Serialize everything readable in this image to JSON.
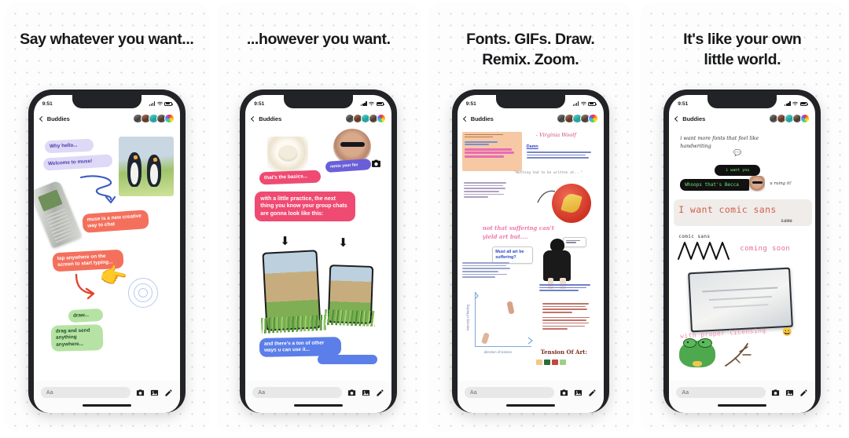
{
  "app": {
    "name": "muse",
    "status_time": "9:51",
    "nav_back_label": "Buddies",
    "input_placeholder": "Aa",
    "input_icons": [
      "camera-icon",
      "photo-icon",
      "pencil-icon"
    ],
    "status_icons": [
      "signal-icon",
      "wifi-icon",
      "battery-icon"
    ],
    "avatar_count": 5
  },
  "colors": {
    "page_bg": "#ffffff",
    "panel_bg": "#fdfdfd",
    "dot": "#d8d8d8",
    "heading": "#17181a",
    "bubble_lavender": "#ddd9f7",
    "bubble_coral": "#f4705d",
    "bubble_green": "#b6e3a4",
    "bubble_pink": "#ef4a72",
    "bubble_blue": "#5b7ee8",
    "bubble_indigo": "#6a5fd8",
    "terminal_black": "#111111",
    "terminal_green": "#6de06d",
    "comic_sans_red": "#d1604b",
    "note_orange": "#f6c9a4"
  },
  "panels": [
    {
      "id": "panel-1",
      "title": "Say whatever you want...",
      "messages": [
        {
          "text": "Why hello...",
          "style": "lavender"
        },
        {
          "text": "Welcome to muse!",
          "style": "lavender"
        },
        {
          "text": "muse is a new creative way to chat",
          "style": "coral"
        },
        {
          "text": "tap anywhere on the screen to start typing...",
          "style": "coral"
        },
        {
          "text": "draw...",
          "style": "green"
        },
        {
          "text": "drag and send anything anywhere...",
          "style": "green"
        }
      ],
      "stickers": [
        "penguins-sticker",
        "old-cellphone-sticker",
        "pointing-hand-sticker",
        "squiggle-arrow",
        "curved-arrow",
        "tap-ripple"
      ]
    },
    {
      "id": "panel-2",
      "title": "...however you want.",
      "messages": [
        {
          "text": "remix your fav",
          "style": "indigo"
        },
        {
          "text": "that's the basics...",
          "style": "pink"
        },
        {
          "text": "with a little practice, the next thing you know your group chats are gonna look like this:",
          "style": "pink"
        },
        {
          "text": "and there's a ton of other ways u can use it...",
          "style": "blue"
        },
        {
          "text": "",
          "style": "blue"
        }
      ],
      "stickers": [
        "puppy-photo",
        "sunglasses-face-photo",
        "camera-icon-sticker",
        "arrow-down-left",
        "arrow-down-right",
        "phone-screenshot-large",
        "phone-screenshot-small",
        "grass-sticker"
      ]
    },
    {
      "id": "panel-3",
      "title": "Fonts. GIFs. Draw.\nRemix. Zoom.",
      "quote_attribution": "- Virginia Woolf",
      "messages": [
        {
          "text": "Damn",
          "style": "doc-link"
        },
        {
          "text": "It's pretty interesting how so much art comes from just really deep suffering",
          "style": "mono-blue"
        },
        {
          "text": "\"Nothing had to be written at...\"",
          "style": "mono-grey"
        },
        {
          "text": "yeah it sparked a whole conversation, because some people had like 2 hard really good again we do the direct result of suffering",
          "style": "mono-grey"
        },
        {
          "text": "not that suffering can't yield art but....",
          "style": "pink-handwriting"
        },
        {
          "text": "Must all art be suffering?",
          "style": "callout-blue"
        },
        {
          "text": "yeah yes definitely comes from intense feelings, but not necessarily those suffering....",
          "style": "mono-blue"
        },
        {
          "text": "although I do think it comes from \"tension\" and that tension can often manifest as suffering",
          "style": "mono-red"
        },
        {
          "text": "But I'm feeling lately like the people who really figure life out are the ones who learn to bask in that tension & seek it out rather than attribute it to suffering",
          "style": "mono-red"
        }
      ],
      "section_heading": "Tension Of Art:",
      "chart": {
        "ylabel": "intensity of feeling",
        "xlabel": "direction of tension"
      },
      "stickers": [
        "orange-note-card",
        "red-leaf-badge",
        "goth-figure-photo",
        "speech-callout",
        "scatter-chart",
        "color-swatches"
      ]
    },
    {
      "id": "panel-4",
      "title": "It's like your own\nlittle world.",
      "messages": [
        {
          "text": "i want more fonts that feel like handwriting",
          "style": "handwriting"
        },
        {
          "text": "i want you",
          "style": "terminal"
        },
        {
          "text": "Whoops that's Becca",
          "style": "terminal"
        },
        {
          "text": "u ruing it!",
          "style": "handwriting-small"
        },
        {
          "text": "I want comic sans",
          "style": "comic-big"
        },
        {
          "text": "same",
          "style": "comic-small"
        },
        {
          "text": "comic sans",
          "style": "comic-label"
        },
        {
          "text": "coming soon",
          "style": "comic-pink"
        },
        {
          "text": "with proper licensing",
          "style": "comic-pink-outline"
        }
      ],
      "emoji": "😀",
      "stickers": [
        "handwriting-emoji",
        "becca-face-photo",
        "zigzag-scribble",
        "tablet-photo",
        "frog-sticker",
        "branch-sticker"
      ]
    }
  ]
}
